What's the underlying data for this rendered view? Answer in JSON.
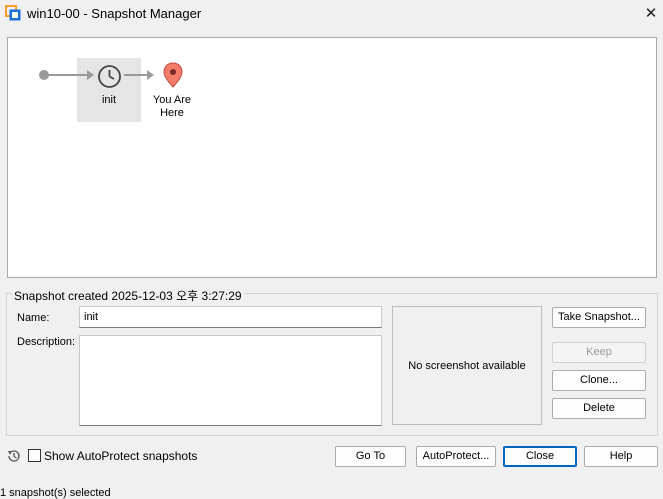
{
  "window": {
    "title": "win10-00 - Snapshot Manager",
    "icon": "vmware-app-icon",
    "close_label": "✕"
  },
  "tree": {
    "nodes": [
      {
        "label": "init",
        "icon": "clock-icon"
      },
      {
        "label_line1": "You Are",
        "label_line2": "Here",
        "icon": "location-pin-icon"
      }
    ],
    "colors": {
      "connector": "#a0a0a0",
      "pin": "#f47c6b",
      "selected_bg": "#e5e5e5"
    }
  },
  "details": {
    "group_title": "Snapshot created 2025-12-03 오후 3:27:29",
    "name_label": "Name:",
    "name_value": "init",
    "description_label": "Description:",
    "description_value": "",
    "preview_text": "No screenshot available"
  },
  "actions": {
    "take_snapshot": "Take Snapshot...",
    "keep": "Keep",
    "clone": "Clone...",
    "delete": "Delete"
  },
  "footer": {
    "history_icon": "history-icon",
    "show_autoprotect_label": "Show AutoProtect snapshots",
    "show_autoprotect_checked": false,
    "go_to": "Go To",
    "autoprotect": "AutoProtect...",
    "close": "Close",
    "help": "Help"
  },
  "status": {
    "text": "1 snapshot(s) selected"
  }
}
